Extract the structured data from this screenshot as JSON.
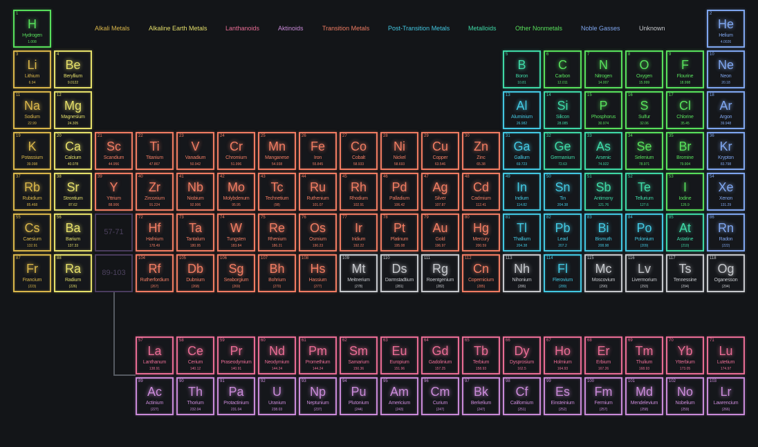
{
  "legend": [
    {
      "key": "alkali",
      "label": "Alkali Metals",
      "color": "#d9b64a"
    },
    {
      "key": "alkaline",
      "label": "Alkaline Earth Metals",
      "color": "#e5df6a"
    },
    {
      "key": "lanthanoid",
      "label": "Lanthanoids",
      "color": "#e86c94"
    },
    {
      "key": "actinoid",
      "label": "Aktinoids",
      "color": "#c98ad8"
    },
    {
      "key": "transition",
      "label": "Transition Metals",
      "color": "#f07c62"
    },
    {
      "key": "post",
      "label": "Post-Transition Metals",
      "color": "#43c8e2"
    },
    {
      "key": "metalloid",
      "label": "Metalloids",
      "color": "#3fd9a6"
    },
    {
      "key": "nonmetal",
      "label": "Other Nonmetals",
      "color": "#58e05c"
    },
    {
      "key": "noble",
      "label": "Noble Gasses",
      "color": "#7fa6ef"
    },
    {
      "key": "unknown",
      "label": "Unknown",
      "color": "#c6c8cc"
    }
  ],
  "placeholders": {
    "lanthanoids": "57-71",
    "actinoids": "89-103"
  },
  "elements": [
    {
      "n": 1,
      "s": "H",
      "name": "Hydrogen",
      "m": "1.008",
      "cat": "nonmetal",
      "row": 1,
      "col": 1
    },
    {
      "n": 2,
      "s": "He",
      "name": "Helium",
      "m": "4.0026",
      "cat": "noble",
      "row": 1,
      "col": 18
    },
    {
      "n": 3,
      "s": "Li",
      "name": "Lithium",
      "m": "6.94",
      "cat": "alkali",
      "row": 2,
      "col": 1
    },
    {
      "n": 4,
      "s": "Be",
      "name": "Beryllium",
      "m": "9.0122",
      "cat": "alkaline",
      "row": 2,
      "col": 2
    },
    {
      "n": 5,
      "s": "B",
      "name": "Boron",
      "m": "10.81",
      "cat": "metalloid",
      "row": 2,
      "col": 13
    },
    {
      "n": 6,
      "s": "C",
      "name": "Carbon",
      "m": "12.011",
      "cat": "nonmetal",
      "row": 2,
      "col": 14
    },
    {
      "n": 7,
      "s": "N",
      "name": "Nitrogen",
      "m": "14.007",
      "cat": "nonmetal",
      "row": 2,
      "col": 15
    },
    {
      "n": 8,
      "s": "O",
      "name": "Oxygen",
      "m": "15.999",
      "cat": "nonmetal",
      "row": 2,
      "col": 16
    },
    {
      "n": 9,
      "s": "F",
      "name": "Flourine",
      "m": "18.998",
      "cat": "nonmetal",
      "row": 2,
      "col": 17
    },
    {
      "n": 10,
      "s": "Ne",
      "name": "Neon",
      "m": "20.18",
      "cat": "noble",
      "row": 2,
      "col": 18
    },
    {
      "n": 11,
      "s": "Na",
      "name": "Sodium",
      "m": "22.99",
      "cat": "alkali",
      "row": 3,
      "col": 1
    },
    {
      "n": 12,
      "s": "Mg",
      "name": "Magnesium",
      "m": "24.305",
      "cat": "alkaline",
      "row": 3,
      "col": 2
    },
    {
      "n": 13,
      "s": "Al",
      "name": "Aluminium",
      "m": "26.982",
      "cat": "post",
      "row": 3,
      "col": 13
    },
    {
      "n": 14,
      "s": "Si",
      "name": "Silicon",
      "m": "28.085",
      "cat": "metalloid",
      "row": 3,
      "col": 14
    },
    {
      "n": 15,
      "s": "P",
      "name": "Phosphorus",
      "m": "30.974",
      "cat": "nonmetal",
      "row": 3,
      "col": 15
    },
    {
      "n": 16,
      "s": "S",
      "name": "Sulfur",
      "m": "32.06",
      "cat": "nonmetal",
      "row": 3,
      "col": 16
    },
    {
      "n": 17,
      "s": "Cl",
      "name": "Chlorine",
      "m": "35.45",
      "cat": "nonmetal",
      "row": 3,
      "col": 17
    },
    {
      "n": 18,
      "s": "Ar",
      "name": "Argon",
      "m": "39.948",
      "cat": "noble",
      "row": 3,
      "col": 18
    },
    {
      "n": 19,
      "s": "K",
      "name": "Potassium",
      "m": "39.098",
      "cat": "alkali",
      "row": 4,
      "col": 1
    },
    {
      "n": 20,
      "s": "Ca",
      "name": "Calcium",
      "m": "40.078",
      "cat": "alkaline",
      "row": 4,
      "col": 2
    },
    {
      "n": 21,
      "s": "Sc",
      "name": "Scandium",
      "m": "44.956",
      "cat": "transition",
      "row": 4,
      "col": 3
    },
    {
      "n": 22,
      "s": "Ti",
      "name": "Titanium",
      "m": "47.867",
      "cat": "transition",
      "row": 4,
      "col": 4
    },
    {
      "n": 23,
      "s": "V",
      "name": "Vanadium",
      "m": "50.942",
      "cat": "transition",
      "row": 4,
      "col": 5
    },
    {
      "n": 24,
      "s": "Cr",
      "name": "Chromium",
      "m": "51.996",
      "cat": "transition",
      "row": 4,
      "col": 6
    },
    {
      "n": 25,
      "s": "Mn",
      "name": "Manganese",
      "m": "54.938",
      "cat": "transition",
      "row": 4,
      "col": 7
    },
    {
      "n": 26,
      "s": "Fe",
      "name": "Iron",
      "m": "55.845",
      "cat": "transition",
      "row": 4,
      "col": 8
    },
    {
      "n": 27,
      "s": "Co",
      "name": "Cobalt",
      "m": "58.933",
      "cat": "transition",
      "row": 4,
      "col": 9
    },
    {
      "n": 28,
      "s": "Ni",
      "name": "Nickel",
      "m": "58.693",
      "cat": "transition",
      "row": 4,
      "col": 10
    },
    {
      "n": 29,
      "s": "Cu",
      "name": "Copper",
      "m": "63.546",
      "cat": "transition",
      "row": 4,
      "col": 11
    },
    {
      "n": 30,
      "s": "Zn",
      "name": "Zinc",
      "m": "65.38",
      "cat": "transition",
      "row": 4,
      "col": 12
    },
    {
      "n": 31,
      "s": "Ga",
      "name": "Gallium",
      "m": "69.723",
      "cat": "post",
      "row": 4,
      "col": 13
    },
    {
      "n": 32,
      "s": "Ge",
      "name": "Germanium",
      "m": "72.63",
      "cat": "metalloid",
      "row": 4,
      "col": 14
    },
    {
      "n": 33,
      "s": "As",
      "name": "Arsenic",
      "m": "74.922",
      "cat": "metalloid",
      "row": 4,
      "col": 15
    },
    {
      "n": 34,
      "s": "Se",
      "name": "Selenium",
      "m": "78.971",
      "cat": "nonmetal",
      "row": 4,
      "col": 16
    },
    {
      "n": 35,
      "s": "Br",
      "name": "Bromine",
      "m": "79.904",
      "cat": "nonmetal",
      "row": 4,
      "col": 17
    },
    {
      "n": 36,
      "s": "Kr",
      "name": "Krypton",
      "m": "83.798",
      "cat": "noble",
      "row": 4,
      "col": 18
    },
    {
      "n": 37,
      "s": "Rb",
      "name": "Rubidium",
      "m": "85.468",
      "cat": "alkali",
      "row": 5,
      "col": 1
    },
    {
      "n": 38,
      "s": "Sr",
      "name": "Strontium",
      "m": "87.62",
      "cat": "alkaline",
      "row": 5,
      "col": 2
    },
    {
      "n": 39,
      "s": "Y",
      "name": "Yttrium",
      "m": "88.906",
      "cat": "transition",
      "row": 5,
      "col": 3
    },
    {
      "n": 40,
      "s": "Zr",
      "name": "Zirconium",
      "m": "91.224",
      "cat": "transition",
      "row": 5,
      "col": 4
    },
    {
      "n": 41,
      "s": "Nb",
      "name": "Niobium",
      "m": "92.906",
      "cat": "transition",
      "row": 5,
      "col": 5
    },
    {
      "n": 42,
      "s": "Mo",
      "name": "Molybdenum",
      "m": "95.95",
      "cat": "transition",
      "row": 5,
      "col": 6
    },
    {
      "n": 43,
      "s": "Tc",
      "name": "Technetium",
      "m": "(98)",
      "cat": "transition",
      "row": 5,
      "col": 7
    },
    {
      "n": 44,
      "s": "Ru",
      "name": "Ruthenium",
      "m": "101.07",
      "cat": "transition",
      "row": 5,
      "col": 8
    },
    {
      "n": 45,
      "s": "Rh",
      "name": "Rhodium",
      "m": "102.91",
      "cat": "transition",
      "row": 5,
      "col": 9
    },
    {
      "n": 46,
      "s": "Pd",
      "name": "Palladium",
      "m": "106.42",
      "cat": "transition",
      "row": 5,
      "col": 10
    },
    {
      "n": 47,
      "s": "Ag",
      "name": "Silver",
      "m": "107.87",
      "cat": "transition",
      "row": 5,
      "col": 11
    },
    {
      "n": 48,
      "s": "Cd",
      "name": "Cadmium",
      "m": "112.41",
      "cat": "transition",
      "row": 5,
      "col": 12
    },
    {
      "n": 49,
      "s": "In",
      "name": "Indium",
      "m": "114.82",
      "cat": "post",
      "row": 5,
      "col": 13
    },
    {
      "n": 50,
      "s": "Sn",
      "name": "Tin",
      "m": "204.38",
      "cat": "post",
      "row": 5,
      "col": 14
    },
    {
      "n": 51,
      "s": "Sb",
      "name": "Antimony",
      "m": "121.76",
      "cat": "metalloid",
      "row": 5,
      "col": 15
    },
    {
      "n": 52,
      "s": "Te",
      "name": "Tellurium",
      "m": "127.6",
      "cat": "metalloid",
      "row": 5,
      "col": 16
    },
    {
      "n": 53,
      "s": "I",
      "name": "Iodine",
      "m": "126.9",
      "cat": "nonmetal",
      "row": 5,
      "col": 17
    },
    {
      "n": 54,
      "s": "Xe",
      "name": "Xenon",
      "m": "131.29",
      "cat": "noble",
      "row": 5,
      "col": 18
    },
    {
      "n": 55,
      "s": "Cs",
      "name": "Caesium",
      "m": "132.91",
      "cat": "alkali",
      "row": 6,
      "col": 1
    },
    {
      "n": 56,
      "s": "Ba",
      "name": "Barium",
      "m": "137.33",
      "cat": "alkaline",
      "row": 6,
      "col": 2
    },
    {
      "n": 72,
      "s": "Hf",
      "name": "Hafnium",
      "m": "178.49",
      "cat": "transition",
      "row": 6,
      "col": 4
    },
    {
      "n": 73,
      "s": "Ta",
      "name": "Tantalum",
      "m": "180.95",
      "cat": "transition",
      "row": 6,
      "col": 5
    },
    {
      "n": 74,
      "s": "W",
      "name": "Tungsten",
      "m": "183.84",
      "cat": "transition",
      "row": 6,
      "col": 6
    },
    {
      "n": 75,
      "s": "Re",
      "name": "Rhenium",
      "m": "186.21",
      "cat": "transition",
      "row": 6,
      "col": 7
    },
    {
      "n": 76,
      "s": "Os",
      "name": "Osmium",
      "m": "190.23",
      "cat": "transition",
      "row": 6,
      "col": 8
    },
    {
      "n": 77,
      "s": "Ir",
      "name": "Iridium",
      "m": "192.22",
      "cat": "transition",
      "row": 6,
      "col": 9
    },
    {
      "n": 78,
      "s": "Pt",
      "name": "Platinum",
      "m": "195.08",
      "cat": "transition",
      "row": 6,
      "col": 10
    },
    {
      "n": 79,
      "s": "Au",
      "name": "Gold",
      "m": "196.97",
      "cat": "transition",
      "row": 6,
      "col": 11
    },
    {
      "n": 80,
      "s": "Hg",
      "name": "Mercury",
      "m": "200.59",
      "cat": "transition",
      "row": 6,
      "col": 12
    },
    {
      "n": 81,
      "s": "Tl",
      "name": "Thallium",
      "m": "204.38",
      "cat": "post",
      "row": 6,
      "col": 13
    },
    {
      "n": 82,
      "s": "Pb",
      "name": "Lead",
      "m": "207.2",
      "cat": "post",
      "row": 6,
      "col": 14
    },
    {
      "n": 83,
      "s": "Bi",
      "name": "Bismuth",
      "m": "208.98",
      "cat": "post",
      "row": 6,
      "col": 15
    },
    {
      "n": 84,
      "s": "Po",
      "name": "Polonium",
      "m": "(209)",
      "cat": "post",
      "row": 6,
      "col": 16
    },
    {
      "n": 85,
      "s": "At",
      "name": "Astatine",
      "m": "(210)",
      "cat": "metalloid",
      "row": 6,
      "col": 17
    },
    {
      "n": 86,
      "s": "Rn",
      "name": "Radon",
      "m": "(222)",
      "cat": "noble",
      "row": 6,
      "col": 18
    },
    {
      "n": 87,
      "s": "Fr",
      "name": "Francium",
      "m": "(223)",
      "cat": "alkali",
      "row": 7,
      "col": 1
    },
    {
      "n": 88,
      "s": "Ra",
      "name": "Radium",
      "m": "(226)",
      "cat": "alkaline",
      "row": 7,
      "col": 2
    },
    {
      "n": 104,
      "s": "Rf",
      "name": "Rutherfordium",
      "m": "(267)",
      "cat": "transition",
      "row": 7,
      "col": 4
    },
    {
      "n": 105,
      "s": "Db",
      "name": "Dubnium",
      "m": "(268)",
      "cat": "transition",
      "row": 7,
      "col": 5
    },
    {
      "n": 106,
      "s": "Sg",
      "name": "Seaborgium",
      "m": "(269)",
      "cat": "transition",
      "row": 7,
      "col": 6
    },
    {
      "n": 107,
      "s": "Bh",
      "name": "Bohrium",
      "m": "(270)",
      "cat": "transition",
      "row": 7,
      "col": 7
    },
    {
      "n": 108,
      "s": "Hs",
      "name": "Hassium",
      "m": "(277)",
      "cat": "transition",
      "row": 7,
      "col": 8
    },
    {
      "n": 109,
      "s": "Mt",
      "name": "Meitnerium",
      "m": "(278)",
      "cat": "unknown",
      "row": 7,
      "col": 9
    },
    {
      "n": 110,
      "s": "Ds",
      "name": "Darmstadtium",
      "m": "(281)",
      "cat": "unknown",
      "row": 7,
      "col": 10
    },
    {
      "n": 111,
      "s": "Rg",
      "name": "Roentgenium",
      "m": "(282)",
      "cat": "unknown",
      "row": 7,
      "col": 11
    },
    {
      "n": 112,
      "s": "Cn",
      "name": "Copernicium",
      "m": "(285)",
      "cat": "transition",
      "row": 7,
      "col": 12
    },
    {
      "n": 113,
      "s": "Nh",
      "name": "Nihonium",
      "m": "(286)",
      "cat": "unknown",
      "row": 7,
      "col": 13
    },
    {
      "n": 114,
      "s": "Fl",
      "name": "Flerovium",
      "m": "(289)",
      "cat": "post",
      "row": 7,
      "col": 14
    },
    {
      "n": 115,
      "s": "Mc",
      "name": "Moscovium",
      "m": "(290)",
      "cat": "unknown",
      "row": 7,
      "col": 15
    },
    {
      "n": 116,
      "s": "Lv",
      "name": "Livermorium",
      "m": "(293)",
      "cat": "unknown",
      "row": 7,
      "col": 16
    },
    {
      "n": 117,
      "s": "Ts",
      "name": "Tennessine",
      "m": "(294)",
      "cat": "unknown",
      "row": 7,
      "col": 17
    },
    {
      "n": 118,
      "s": "Og",
      "name": "Oganesson",
      "m": "(294)",
      "cat": "unknown",
      "row": 7,
      "col": 18
    },
    {
      "n": 57,
      "s": "La",
      "name": "Lanthanum",
      "m": "138.91",
      "cat": "lanthanoid",
      "row": 9,
      "col": 4
    },
    {
      "n": 58,
      "s": "Ce",
      "name": "Cerium",
      "m": "140.12",
      "cat": "lanthanoid",
      "row": 9,
      "col": 5
    },
    {
      "n": 59,
      "s": "Pr",
      "name": "Praseodymium",
      "m": "140.91",
      "cat": "lanthanoid",
      "row": 9,
      "col": 6
    },
    {
      "n": 60,
      "s": "Nd",
      "name": "Neodymium",
      "m": "144.24",
      "cat": "lanthanoid",
      "row": 9,
      "col": 7
    },
    {
      "n": 61,
      "s": "Pm",
      "name": "Promethium",
      "m": "144.24",
      "cat": "lanthanoid",
      "row": 9,
      "col": 8
    },
    {
      "n": 62,
      "s": "Sm",
      "name": "Samarium",
      "m": "150.36",
      "cat": "lanthanoid",
      "row": 9,
      "col": 9
    },
    {
      "n": 63,
      "s": "Eu",
      "name": "Europium",
      "m": "151.96",
      "cat": "lanthanoid",
      "row": 9,
      "col": 10
    },
    {
      "n": 64,
      "s": "Gd",
      "name": "Gadolinium",
      "m": "157.25",
      "cat": "lanthanoid",
      "row": 9,
      "col": 11
    },
    {
      "n": 65,
      "s": "Tb",
      "name": "Terbium",
      "m": "158.93",
      "cat": "lanthanoid",
      "row": 9,
      "col": 12
    },
    {
      "n": 66,
      "s": "Dy",
      "name": "Dysprosium",
      "m": "162.5",
      "cat": "lanthanoid",
      "row": 9,
      "col": 13
    },
    {
      "n": 67,
      "s": "Ho",
      "name": "Holmium",
      "m": "164.93",
      "cat": "lanthanoid",
      "row": 9,
      "col": 14
    },
    {
      "n": 68,
      "s": "Er",
      "name": "Erbium",
      "m": "167.26",
      "cat": "lanthanoid",
      "row": 9,
      "col": 15
    },
    {
      "n": 69,
      "s": "Tm",
      "name": "Thulium",
      "m": "168.93",
      "cat": "lanthanoid",
      "row": 9,
      "col": 16
    },
    {
      "n": 70,
      "s": "Yb",
      "name": "Ytterbium",
      "m": "173.05",
      "cat": "lanthanoid",
      "row": 9,
      "col": 17
    },
    {
      "n": 71,
      "s": "Lu",
      "name": "Lutetium",
      "m": "174.97",
      "cat": "lanthanoid",
      "row": 9,
      "col": 18
    },
    {
      "n": 89,
      "s": "Ac",
      "name": "Actinium",
      "m": "(227)",
      "cat": "actinoid",
      "row": 10,
      "col": 4
    },
    {
      "n": 90,
      "s": "Th",
      "name": "Thorium",
      "m": "232.04",
      "cat": "actinoid",
      "row": 10,
      "col": 5
    },
    {
      "n": 91,
      "s": "Pa",
      "name": "Protactinium",
      "m": "231.04",
      "cat": "actinoid",
      "row": 10,
      "col": 6
    },
    {
      "n": 92,
      "s": "U",
      "name": "Uranium",
      "m": "238.03",
      "cat": "actinoid",
      "row": 10,
      "col": 7
    },
    {
      "n": 93,
      "s": "Np",
      "name": "Neptunium",
      "m": "(237)",
      "cat": "actinoid",
      "row": 10,
      "col": 8
    },
    {
      "n": 94,
      "s": "Pu",
      "name": "Plutonium",
      "m": "(244)",
      "cat": "actinoid",
      "row": 10,
      "col": 9
    },
    {
      "n": 95,
      "s": "Am",
      "name": "Americium",
      "m": "(243)",
      "cat": "actinoid",
      "row": 10,
      "col": 10
    },
    {
      "n": 96,
      "s": "Cm",
      "name": "Curium",
      "m": "(247)",
      "cat": "actinoid",
      "row": 10,
      "col": 11
    },
    {
      "n": 97,
      "s": "Bk",
      "name": "Berkelium",
      "m": "(247)",
      "cat": "actinoid",
      "row": 10,
      "col": 12
    },
    {
      "n": 98,
      "s": "Cf",
      "name": "Californium",
      "m": "(251)",
      "cat": "actinoid",
      "row": 10,
      "col": 13
    },
    {
      "n": 99,
      "s": "Es",
      "name": "Einsteinium",
      "m": "(252)",
      "cat": "actinoid",
      "row": 10,
      "col": 14
    },
    {
      "n": 100,
      "s": "Fm",
      "name": "Fermium",
      "m": "(257)",
      "cat": "actinoid",
      "row": 10,
      "col": 15
    },
    {
      "n": 101,
      "s": "Md",
      "name": "Mendelevium",
      "m": "(258)",
      "cat": "actinoid",
      "row": 10,
      "col": 16
    },
    {
      "n": 102,
      "s": "No",
      "name": "Nobelium",
      "m": "(259)",
      "cat": "actinoid",
      "row": 10,
      "col": 17
    },
    {
      "n": 103,
      "s": "Lr",
      "name": "Lawrencium",
      "m": "(266)",
      "cat": "actinoid",
      "row": 10,
      "col": 18
    }
  ]
}
